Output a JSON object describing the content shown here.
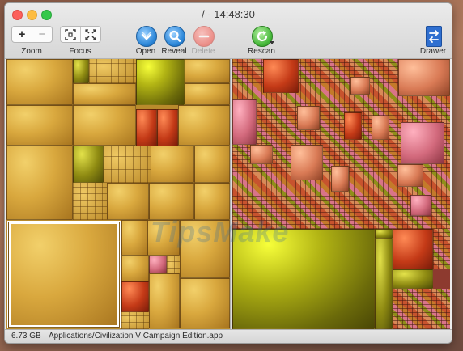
{
  "window": {
    "title": "/ - 14:48:30"
  },
  "toolbar": {
    "zoom_label": "Zoom",
    "zoom_in_glyph": "+",
    "zoom_out_glyph": "−",
    "focus_label": "Focus",
    "open_label": "Open",
    "reveal_label": "Reveal",
    "delete_label": "Delete",
    "rescan_label": "Rescan",
    "drawer_label": "Drawer"
  },
  "icons": {
    "open": "open-icon",
    "reveal": "magnifier-icon",
    "delete": "minus-circle-icon",
    "rescan": "refresh-icon",
    "drawer": "drawer-icon"
  },
  "colors": {
    "gold": "#d9a83e",
    "olive": "#8f8b12",
    "red": "#c43a17",
    "pink": "#d36a7d"
  },
  "status": {
    "size": "6.73 GB",
    "path": "Applications/Civilization V Campaign Edition.app"
  },
  "watermark": "TipsMake"
}
